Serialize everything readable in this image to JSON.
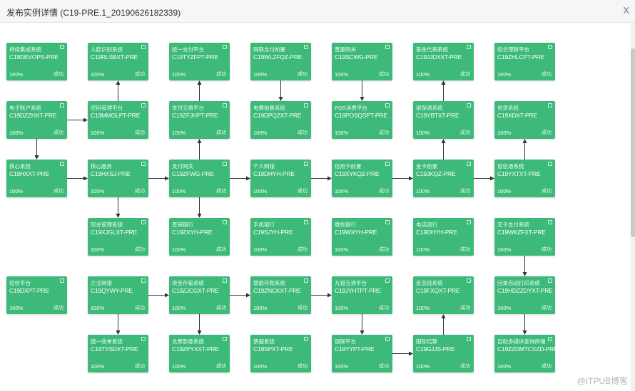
{
  "window": {
    "title": "发布实例详情 (C19-PRE.1_20190626182339)",
    "close_label": "X"
  },
  "watermark": "@ITPUB博客",
  "colors": {
    "node": "#3dba79",
    "edge": "#333333"
  },
  "nodes": [
    {
      "id": "c0r0",
      "col": 0,
      "row": 0,
      "name": "持续集成系统",
      "code": "C19DEVOPS-PRE",
      "progress": "100%",
      "status": "成功"
    },
    {
      "id": "c1r0",
      "col": 1,
      "row": 0,
      "name": "人脸识别系统",
      "code": "C19RLSBXT-PRE",
      "progress": "100%",
      "status": "成功"
    },
    {
      "id": "c2r0",
      "col": 2,
      "row": 0,
      "name": "统一支付平台",
      "code": "C19TYZFPT-PRE",
      "progress": "100%",
      "status": "成功"
    },
    {
      "id": "c3r0",
      "col": 3,
      "row": 0,
      "name": "网联支付前置",
      "code": "C19WLZFQZ-PRE",
      "progress": "100%",
      "status": "成功"
    },
    {
      "id": "c4r0",
      "col": 4,
      "row": 0,
      "name": "普惠网关",
      "code": "C19SCWG-PRE",
      "progress": "100%",
      "status": "成功"
    },
    {
      "id": "c5r0",
      "col": 5,
      "row": 0,
      "name": "基金代销系统",
      "code": "C19JJDXXT-PRE",
      "progress": "100%",
      "status": "成功"
    },
    {
      "id": "c6r0",
      "col": 6,
      "row": 0,
      "name": "综合理财平台",
      "code": "C19ZHLCPT-PRE",
      "progress": "100%",
      "status": "成功"
    },
    {
      "id": "c0r1",
      "col": 0,
      "row": 1,
      "name": "电子账户系统",
      "code": "C19DZZHXT-PRE",
      "progress": "100%",
      "status": "成功"
    },
    {
      "id": "c1r1",
      "col": 1,
      "row": 1,
      "name": "密码管理平台",
      "code": "C19MMGLPT-PRE",
      "progress": "100%",
      "status": "成功"
    },
    {
      "id": "c2r1",
      "col": 2,
      "row": 1,
      "name": "支付交易平台",
      "code": "C19ZFJHPT-PRE",
      "progress": "100%",
      "status": "成功"
    },
    {
      "id": "c3r1",
      "col": 3,
      "row": 1,
      "name": "电票前置系统",
      "code": "C19DPQZXT-PRE",
      "progress": "100%",
      "status": "成功"
    },
    {
      "id": "c4r1",
      "col": 4,
      "row": 1,
      "name": "POS消费平台",
      "code": "C19POSQSPT-PRE",
      "progress": "100%",
      "status": "成功"
    },
    {
      "id": "c5r1",
      "col": 5,
      "row": 1,
      "name": "银保通系统",
      "code": "C19YBTXT-PRE",
      "progress": "100%",
      "status": "成功"
    },
    {
      "id": "c6r1",
      "col": 6,
      "row": 1,
      "name": "信贷系统",
      "code": "C19XDXT-PRE",
      "progress": "100%",
      "status": "成功"
    },
    {
      "id": "c0r2",
      "col": 0,
      "row": 2,
      "name": "核心系统",
      "code": "C19HXXT-PRE",
      "progress": "100%",
      "status": "成功"
    },
    {
      "id": "c1r2",
      "col": 1,
      "row": 2,
      "name": "核心服务",
      "code": "C19HXSJ-PRE",
      "progress": "100%",
      "status": "成功"
    },
    {
      "id": "c2r2",
      "col": 2,
      "row": 2,
      "name": "支付网关",
      "code": "C19ZFWG-PRE",
      "progress": "100%",
      "status": "成功"
    },
    {
      "id": "c3r2",
      "col": 3,
      "row": 2,
      "name": "个人网银",
      "code": "C19DHYH-PRE",
      "progress": "100%",
      "status": "成功"
    },
    {
      "id": "c4r2",
      "col": 4,
      "row": 2,
      "name": "信用卡前置",
      "code": "C19XYKQZ-PRE",
      "progress": "100%",
      "status": "成功"
    },
    {
      "id": "c5r2",
      "col": 5,
      "row": 2,
      "name": "金卡前置",
      "code": "C19JKQZ-PRE",
      "progress": "100%",
      "status": "成功"
    },
    {
      "id": "c6r2",
      "col": 6,
      "row": 2,
      "name": "银信通系统",
      "code": "C19YXTXT-PRE",
      "progress": "100%",
      "status": "成功"
    },
    {
      "id": "c1r3",
      "col": 1,
      "row": 3,
      "name": "现金管理系统",
      "code": "C19XJGLXT-PRE",
      "progress": "100%",
      "status": "成功"
    },
    {
      "id": "c2r3",
      "col": 2,
      "row": 3,
      "name": "直销银行",
      "code": "C19ZXYH-PRE",
      "progress": "100%",
      "status": "成功"
    },
    {
      "id": "c3r3",
      "col": 3,
      "row": 3,
      "name": "手机银行",
      "code": "C19SJYH-PRE",
      "progress": "100%",
      "status": "成功"
    },
    {
      "id": "c4r3",
      "col": 4,
      "row": 3,
      "name": "微信银行",
      "code": "C19WXYH-PRE",
      "progress": "100%",
      "status": "成功"
    },
    {
      "id": "c5r3",
      "col": 5,
      "row": 3,
      "name": "电话银行",
      "code": "C19DHYH-PRE",
      "progress": "100%",
      "status": "成功"
    },
    {
      "id": "c6r3",
      "col": 6,
      "row": 3,
      "name": "无卡支付系统",
      "code": "C19WKZFXT-PRE",
      "progress": "100%",
      "status": "成功"
    },
    {
      "id": "c0r4",
      "col": 0,
      "row": 4,
      "name": "短信平台",
      "code": "C19DXPT-PRE",
      "progress": "100%",
      "status": "成功"
    },
    {
      "id": "c1r4",
      "col": 1,
      "row": 4,
      "name": "企业网银",
      "code": "C19QYWY-PRE",
      "progress": "100%",
      "status": "成功"
    },
    {
      "id": "c2r4",
      "col": 2,
      "row": 4,
      "name": "资金存管系统",
      "code": "C19ZJCGXT-PRE",
      "progress": "100%",
      "status": "成功"
    },
    {
      "id": "c3r4",
      "col": 3,
      "row": 4,
      "name": "智能存款系统",
      "code": "C19ZNCKXT-PRE",
      "progress": "100%",
      "status": "成功"
    },
    {
      "id": "c4r4",
      "col": 4,
      "row": 4,
      "name": "九银互通平台",
      "code": "C19JYHTPT-PRE",
      "progress": "100%",
      "status": "成功"
    },
    {
      "id": "c5r4",
      "col": 5,
      "row": 4,
      "name": "反洗钱系统",
      "code": "C19FXQXT-PRE",
      "progress": "100%",
      "status": "成功"
    },
    {
      "id": "c6r4",
      "col": 6,
      "row": 4,
      "name": "回单自动打印系统",
      "code": "C19HDZZDYXT-PRE",
      "progress": "100%",
      "status": "成功"
    },
    {
      "id": "c1r5",
      "col": 1,
      "row": 5,
      "name": "统一收单系统",
      "code": "C19TYSDXT-PRE",
      "progress": "100%",
      "status": "成功"
    },
    {
      "id": "c2r5",
      "col": 2,
      "row": 5,
      "name": "支票影像系统",
      "code": "C19ZPYXXT-PRE",
      "progress": "100%",
      "status": "成功"
    },
    {
      "id": "c3r5",
      "col": 3,
      "row": 5,
      "name": "票据系统",
      "code": "C19SPXT-PRE",
      "progress": "100%",
      "status": "成功"
    },
    {
      "id": "c4r5",
      "col": 4,
      "row": 5,
      "name": "银联平台",
      "code": "C19YYPT-PRE",
      "progress": "100%",
      "status": "成功"
    },
    {
      "id": "c5r5",
      "col": 5,
      "row": 5,
      "name": "国际结算",
      "code": "C19GJJS-PRE",
      "progress": "100%",
      "status": "成功"
    },
    {
      "id": "c6r5",
      "col": 6,
      "row": 5,
      "name": "自助多媒体查询终端",
      "code": "C19ZZDMTCXZD-PRE",
      "progress": "100%",
      "status": "成功"
    }
  ],
  "edges": [
    [
      "c0r1",
      "c1r1"
    ],
    [
      "c1r1",
      "c1r0"
    ],
    [
      "c0r1",
      "c0r2"
    ],
    [
      "c0r2",
      "c1r2"
    ],
    [
      "c1r2",
      "c2r2"
    ],
    [
      "c2r2",
      "c2r1"
    ],
    [
      "c2r1",
      "c2r0"
    ],
    [
      "c2r2",
      "c3r2"
    ],
    [
      "c3r2",
      "c4r2"
    ],
    [
      "c4r2",
      "c5r2"
    ],
    [
      "c5r2",
      "c6r2"
    ],
    [
      "c5r2",
      "c5r1"
    ],
    [
      "c5r1",
      "c5r0"
    ],
    [
      "c6r2",
      "c6r1"
    ],
    [
      "c3r0",
      "c3r1"
    ],
    [
      "c4r0",
      "c4r1"
    ],
    [
      "c1r2",
      "c1r3"
    ],
    [
      "c2r2",
      "c2r3"
    ],
    [
      "c6r3",
      "c6r4"
    ],
    [
      "c6r4",
      "c6r5"
    ],
    [
      "c1r4",
      "c2r4"
    ],
    [
      "c2r4",
      "c3r4"
    ],
    [
      "c3r4",
      "c4r4"
    ],
    [
      "c1r4",
      "c1r5"
    ],
    [
      "c2r4",
      "c2r5"
    ],
    [
      "c4r4",
      "c4r5"
    ],
    [
      "c4r5",
      "c5r5"
    ],
    [
      "c5r5",
      "c5r4"
    ]
  ]
}
